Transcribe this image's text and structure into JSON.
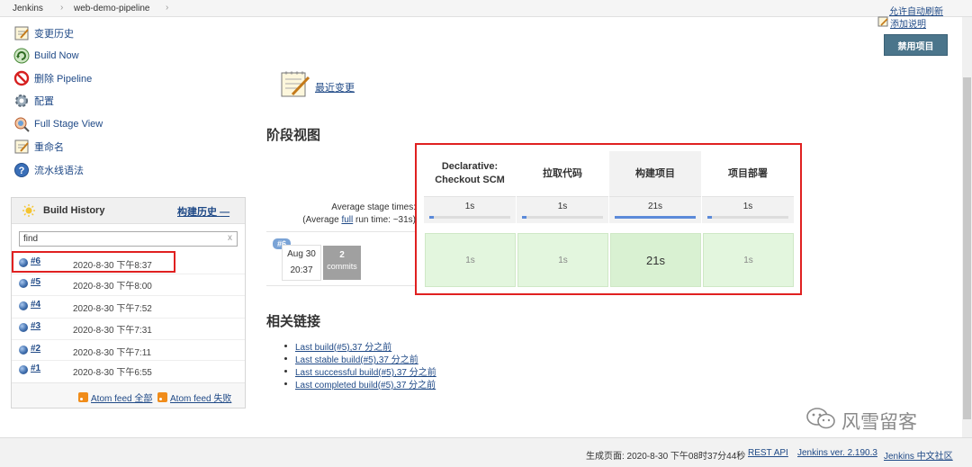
{
  "breadcrumb": {
    "root": "Jenkins",
    "job": "web-demo-pipeline"
  },
  "header": {
    "auto_refresh": "允许自动刷新",
    "edit_description": "添加说明"
  },
  "sidebar": {
    "tasks": [
      {
        "label": "变更历史",
        "icon": "notepad-icon"
      },
      {
        "label": "Build Now",
        "icon": "build-now-icon"
      },
      {
        "label": "删除 Pipeline",
        "icon": "delete-icon"
      },
      {
        "label": "配置",
        "icon": "gear-icon"
      },
      {
        "label": "Full Stage View",
        "icon": "stage-view-icon"
      },
      {
        "label": "重命名",
        "icon": "notepad-icon"
      },
      {
        "label": "流水线语法",
        "icon": "help-icon"
      }
    ]
  },
  "build_history": {
    "title": "Build History",
    "trend_label": "构建历史",
    "trend_symbol": "—",
    "search_value": "find",
    "clear_symbol": "x",
    "builds": [
      {
        "number": "#6",
        "time": "2020-8-30 下午8:37"
      },
      {
        "number": "#5",
        "time": "2020-8-30 下午8:00"
      },
      {
        "number": "#4",
        "time": "2020-8-30 下午7:52"
      },
      {
        "number": "#3",
        "time": "2020-8-30 下午7:31"
      },
      {
        "number": "#2",
        "time": "2020-8-30 下午7:11"
      },
      {
        "number": "#1",
        "time": "2020-8-30 下午6:55"
      }
    ],
    "feed_all": "Atom feed 全部",
    "feed_failed": "Atom feed 失败"
  },
  "main": {
    "recent_changes": "最近变更",
    "stage_view_title": "阶段视图",
    "avg_stage_times": "Average stage times:",
    "avg_run_time_prefix": "(Average ",
    "avg_run_time_link": "full",
    "avg_run_time_suffix": " run time: ~31s)",
    "stages": [
      {
        "name_line1": "Declarative:",
        "name_line2": "Checkout SCM",
        "avg": "1s",
        "avg_fraction": 0.05,
        "run": "1s"
      },
      {
        "name_line1": "拉取代码",
        "name_line2": "",
        "avg": "1s",
        "avg_fraction": 0.05,
        "run": "1s"
      },
      {
        "name_line1": "构建项目",
        "name_line2": "",
        "avg": "21s",
        "avg_fraction": 1.0,
        "run": "21s"
      },
      {
        "name_line1": "项目部署",
        "name_line2": "",
        "avg": "1s",
        "avg_fraction": 0.05,
        "run": "1s"
      }
    ],
    "run": {
      "badge": "#6",
      "date": "Aug 30",
      "time": "20:37",
      "commits_count": "2",
      "commits_label": "commits"
    },
    "related_title": "相关链接",
    "related_links": [
      {
        "text": "Last build(#5),37 分之前"
      },
      {
        "text": "Last stable build(#5),37 分之前"
      },
      {
        "text": "Last successful build(#5),37 分之前"
      },
      {
        "text": "Last completed build(#5),37 分之前"
      }
    ]
  },
  "actions": {
    "disable_project": "禁用项目"
  },
  "watermark": {
    "text": "风雪留客"
  },
  "footer": {
    "generated": "生成页面: 2020-8-30 下午08时37分44秒",
    "rest_api": "REST API",
    "version": "Jenkins ver. 2.190.3",
    "community": "Jenkins 中文社区"
  },
  "colors": {
    "accent": "#204a87",
    "highlight": "#e02020",
    "stage_success": "#e3f6de",
    "disable_button": "#4b758b"
  }
}
